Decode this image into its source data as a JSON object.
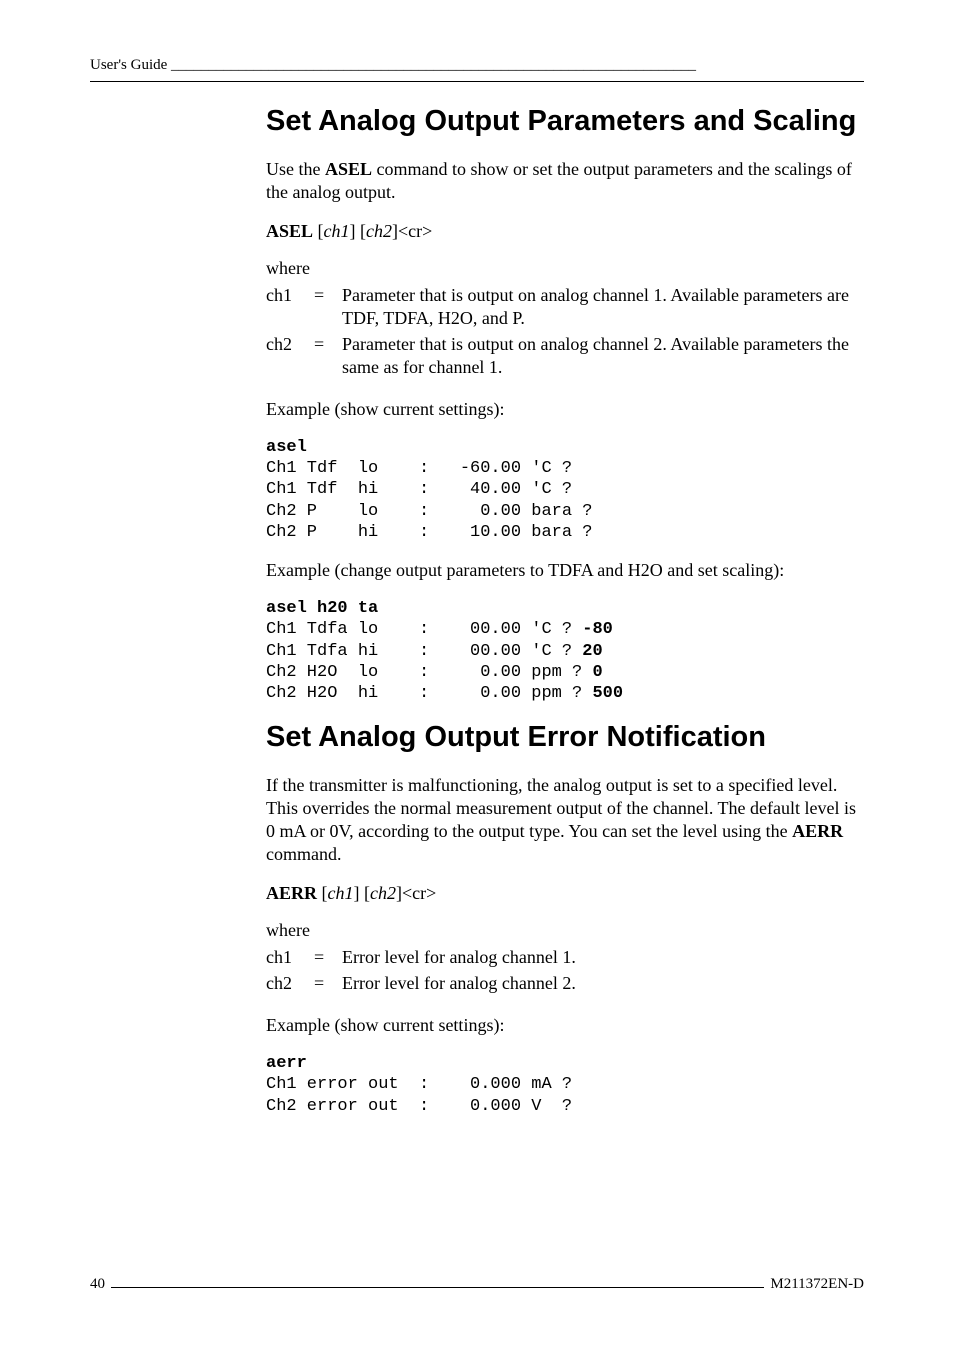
{
  "header": {
    "running": "User's Guide ______________________________________________________________________"
  },
  "labels": {
    "where": "where",
    "eq": "="
  },
  "sections": [
    {
      "title": "Set Analog Output Parameters and Scaling",
      "intro": {
        "pre": "Use the ",
        "cmd": "ASEL",
        "post": " command to show or set the output parameters and the scalings of the analog output."
      },
      "syntax": {
        "cmd": "ASEL",
        "arg1": "ch1",
        "arg2": "ch2",
        "tail": "<cr>"
      },
      "where": [
        {
          "key": "ch1",
          "desc": "Parameter that is output on analog channel 1. Available parameters are TDF, TDFA, H2O, and P."
        },
        {
          "key": "ch2",
          "desc": "Parameter that is output on analog channel 2. Available parameters the same as for channel 1."
        }
      ],
      "example1": {
        "caption": "Example (show current settings):",
        "lines": [
          "asel",
          "Ch1 Tdf  lo    :   -60.00 'C ?",
          "Ch1 Tdf  hi    :    40.00 'C ?",
          "Ch2 P    lo    :     0.00 bara ?",
          "Ch2 P    hi    :    10.00 bara ?"
        ]
      },
      "example2": {
        "caption": "Example (change output parameters to TDFA and H2O and set scaling):",
        "lines": [
          "asel h20 ta",
          {
            "a": "Ch1 Tdfa lo    :    00.00 'C ? ",
            "b": "-80"
          },
          {
            "a": "Ch1 Tdfa hi    :    00.00 'C ? ",
            "b": "20"
          },
          {
            "a": "Ch2 H2O  lo    :     0.00 ppm ? ",
            "b": "0"
          },
          {
            "a": "Ch2 H2O  hi    :     0.00 ppm ? ",
            "b": "500"
          }
        ]
      }
    },
    {
      "title": "Set Analog Output Error Notification",
      "intro": {
        "pre": "If the transmitter is malfunctioning, the analog output is set to a specified level. This overrides the normal measurement output of the channel. The default level is 0 mA or 0V, according to the output type. You can set the level using the ",
        "cmd": "AERR",
        "post": " command."
      },
      "syntax": {
        "cmd": "AERR",
        "arg1": "ch1",
        "arg2": "ch2",
        "tail": "<cr>"
      },
      "where": [
        {
          "key": "ch1",
          "desc": "Error level for analog channel 1."
        },
        {
          "key": "ch2",
          "desc": "Error level for analog channel 2."
        }
      ],
      "example": {
        "caption": "Example (show current settings):",
        "lines": [
          "aerr",
          "Ch1 error out  :    0.000 mA ?",
          "Ch2 error out  :    0.000 V  ?"
        ]
      }
    }
  ],
  "footer": {
    "page": "40",
    "doc_id": "M211372EN-D"
  }
}
